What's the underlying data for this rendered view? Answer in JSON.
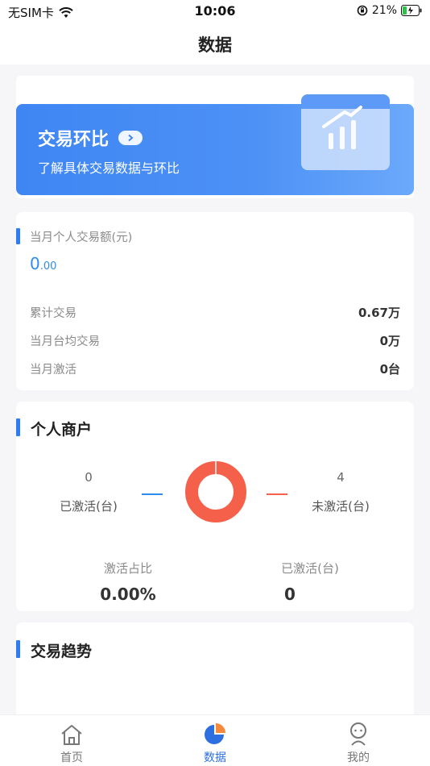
{
  "status_bar": {
    "carrier": "无SIM卡",
    "time": "10:06",
    "battery_percent": "21%"
  },
  "nav": {
    "title": "数据"
  },
  "banner": {
    "title": "交易环比",
    "subtitle": "了解具体交易数据与环比"
  },
  "transactions": {
    "monthly_label": "当月个人交易额(元)",
    "amount_int": "0",
    "amount_dec": ".00",
    "rows": [
      {
        "label": "累计交易",
        "value": "0.67万"
      },
      {
        "label": "当月台均交易",
        "value": "0万"
      },
      {
        "label": "当月激活",
        "value": "0台"
      }
    ]
  },
  "merchant": {
    "title": "个人商户",
    "activated_count": "0",
    "activated_label": "已激活(台)",
    "inactive_count": "4",
    "inactive_label": "未激活(台)",
    "ratio_label": "激活占比",
    "ratio_value": "0.00%",
    "activated_label_2": "已激活(台)",
    "activated_value_2": "0",
    "colors": {
      "activated": "#2d8cf0",
      "inactive": "#f5604a"
    }
  },
  "trend": {
    "title": "交易趋势"
  },
  "tabs": [
    {
      "label": "首页",
      "icon": "home-icon"
    },
    {
      "label": "数据",
      "icon": "pie-chart-icon"
    },
    {
      "label": "我的",
      "icon": "profile-icon"
    }
  ]
}
